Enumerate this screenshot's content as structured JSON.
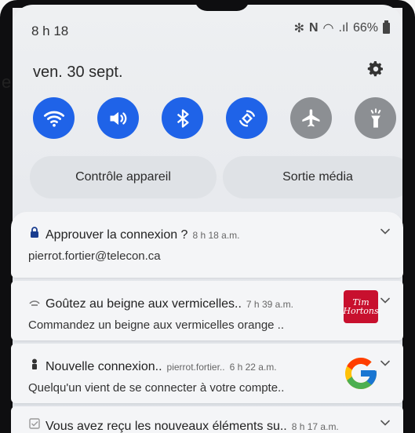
{
  "status": {
    "time": "8 h 18",
    "battery": "66%"
  },
  "header": {
    "date": "ven. 30 sept."
  },
  "edge_text": "e",
  "quick_toggles": [
    {
      "name": "wifi",
      "state": "on"
    },
    {
      "name": "sound",
      "state": "on"
    },
    {
      "name": "bluetooth",
      "state": "on"
    },
    {
      "name": "auto-rotate",
      "state": "on"
    },
    {
      "name": "airplane-mode",
      "state": "off"
    },
    {
      "name": "flashlight",
      "state": "off"
    }
  ],
  "buttons": {
    "device_control": "Contrôle appareil",
    "media_output": "Sortie média"
  },
  "notifications": [
    {
      "icon": "lock-icon",
      "title": "Approuver la connexion ?",
      "time": "8 h 18 a.m.",
      "body": "pierrot.fortier@telecon.ca"
    },
    {
      "icon": "tim-hortons-icon",
      "title": "Goûtez au beigne aux vermicelles..",
      "time": "7 h 39 a.m.",
      "body": "Commandez un beigne aux vermicelles orange ..",
      "logo_line1": "Tim",
      "logo_line2": "Hortons"
    },
    {
      "icon": "user-icon",
      "title": "Nouvelle connexion..",
      "sender": "pierrot.fortier..",
      "time": "6 h 22 a.m.",
      "body": "Quelqu'un vient de se connecter à votre compte.."
    },
    {
      "icon": "checkbox-icon",
      "title": "Vous avez reçu les nouveaux éléments su..",
      "time": "8 h 17 a.m."
    }
  ],
  "colors": {
    "toggle_on": "#1f63e8",
    "toggle_off": "#8c8f93",
    "tim_hortons": "#c8102e"
  }
}
